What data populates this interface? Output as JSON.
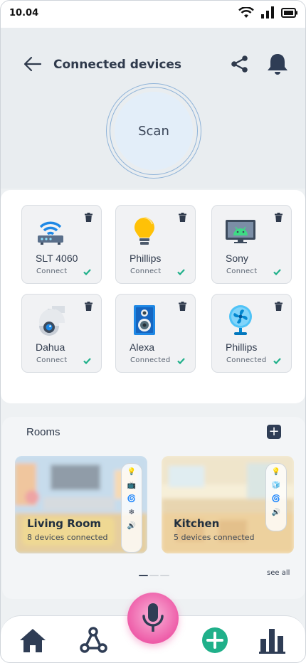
{
  "status_bar": {
    "time": "10.04"
  },
  "header": {
    "title": "Connected devices",
    "scan_label": "Scan"
  },
  "devices": [
    {
      "name": "SLT 4060",
      "status": "Connect",
      "icon": "router-icon"
    },
    {
      "name": "Phillips",
      "status": "Connect",
      "icon": "bulb-icon"
    },
    {
      "name": "Sony",
      "status": "Connect",
      "icon": "android-tv-icon"
    },
    {
      "name": "Dahua",
      "status": "Connect",
      "icon": "security-camera-icon"
    },
    {
      "name": "Alexa",
      "status": "Connected",
      "icon": "speaker-icon"
    },
    {
      "name": "Phillips",
      "status": "Connected",
      "icon": "fan-icon"
    }
  ],
  "rooms": {
    "title": "Rooms",
    "add_label": "+",
    "see_all": "see all",
    "items": [
      {
        "name": "Living Room",
        "count": "8 devices connected",
        "device_icons": [
          "💡",
          "📺",
          "🌀",
          "❄",
          "🔊"
        ]
      },
      {
        "name": "Kitchen",
        "count": "5 devices connected",
        "device_icons": [
          "💡",
          "🧊",
          "🌀",
          "🔊"
        ]
      }
    ],
    "page_count": 3,
    "active_page": 1
  },
  "nav": {
    "items": [
      "home-icon",
      "network-icon",
      "mic-icon",
      "add-icon",
      "stats-icon"
    ]
  },
  "colors": {
    "accent_green": "#20b08a",
    "mic_pink": "#ee5ca8",
    "dark_navy": "#2f3d55"
  }
}
